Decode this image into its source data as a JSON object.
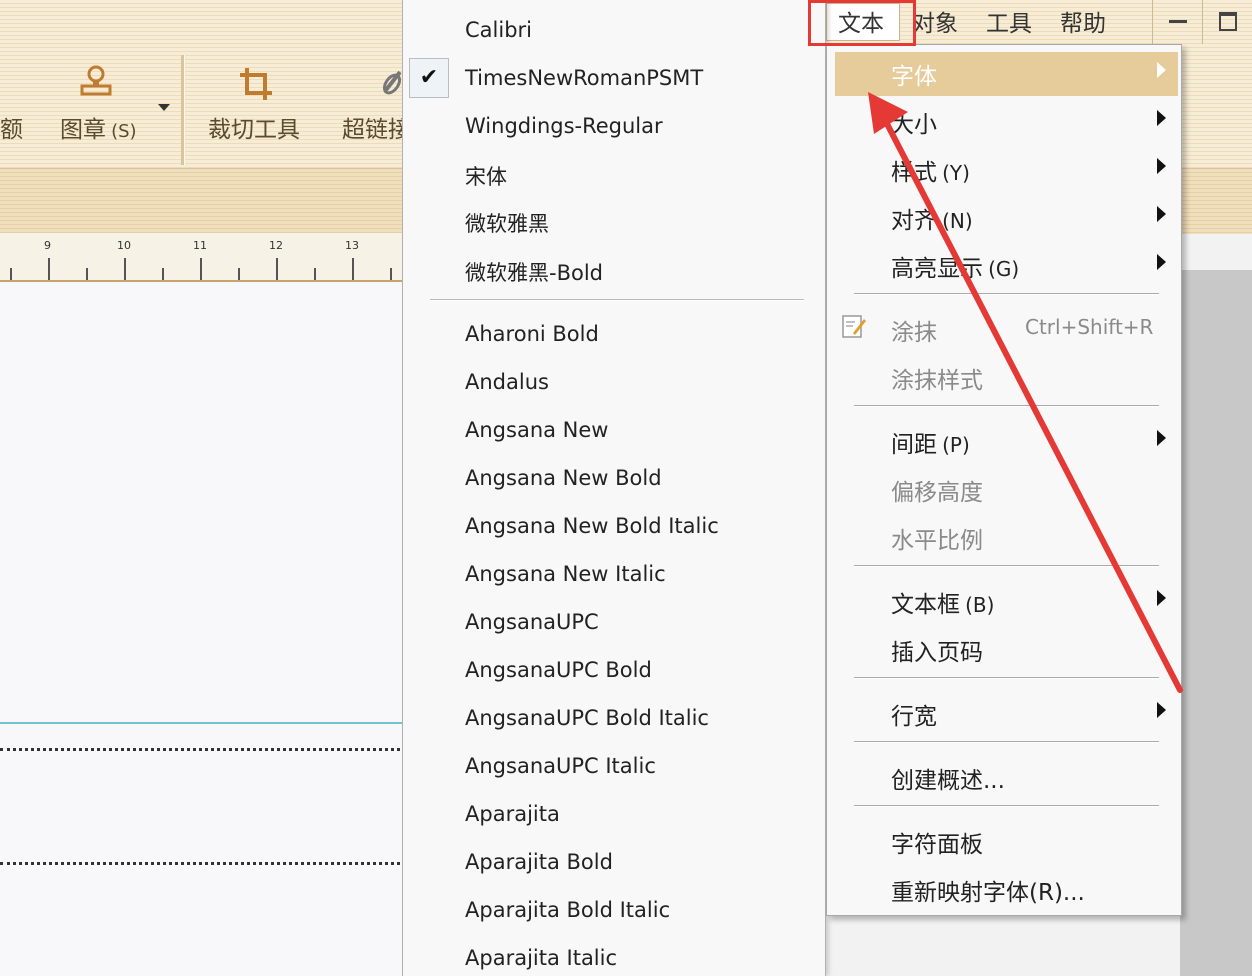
{
  "toolbar": {
    "items": [
      {
        "label": "额",
        "icon": ""
      },
      {
        "label": "图章",
        "shortcut": "(S)",
        "icon": "stamp-icon"
      },
      {
        "label": "裁切工具",
        "icon": "crop-icon"
      },
      {
        "label": "超链接",
        "icon": "link-icon"
      }
    ]
  },
  "menubar": {
    "items": [
      "文本",
      "对象",
      "工具",
      "帮助"
    ]
  },
  "ruler": {
    "numbers": [
      "9",
      "10",
      "11",
      "12",
      "13"
    ]
  },
  "font_menu": {
    "recent": [
      "Calibri",
      "TimesNewRomanPSMT",
      "Wingdings-Regular",
      "宋体",
      "微软雅黑",
      "微软雅黑-Bold"
    ],
    "checked_index": 1,
    "all": [
      "Aharoni Bold",
      "Andalus",
      "Angsana New",
      "Angsana New Bold",
      "Angsana New Bold Italic",
      "Angsana New Italic",
      "AngsanaUPC",
      "AngsanaUPC Bold",
      "AngsanaUPC Bold Italic",
      "AngsanaUPC Italic",
      "Aparajita",
      "Aparajita Bold",
      "Aparajita Bold Italic",
      "Aparajita Italic"
    ]
  },
  "text_menu": {
    "font": "字体",
    "size": "大小",
    "style": "样式",
    "style_key": "(Y)",
    "align": "对齐",
    "align_key": "(N)",
    "highlight": "高亮显示",
    "highlight_key": "(G)",
    "smear": "涂抹",
    "smear_shortcut": "Ctrl+Shift+R",
    "smear_style": "涂抹样式",
    "spacing": "间距",
    "spacing_key": "(P)",
    "offset": "偏移高度",
    "hscale": "水平比例",
    "textbox": "文本框",
    "textbox_key": "(B)",
    "page_number": "插入页码",
    "line_width": "行宽",
    "create_summary": "创建概述...",
    "char_panel": "字符面板",
    "remap": "重新映射字体(R)..."
  },
  "colors": {
    "highlight": "#e6cc9b",
    "annotation": "#e53935"
  }
}
